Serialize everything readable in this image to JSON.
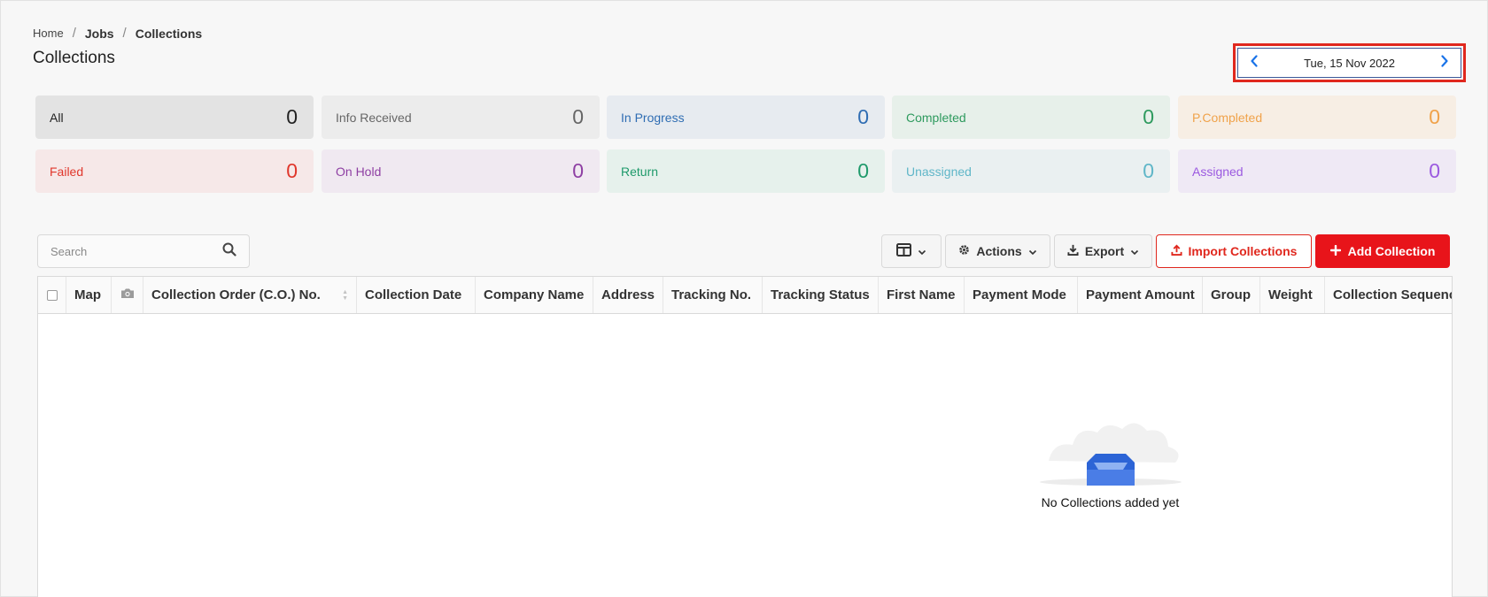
{
  "breadcrumb": {
    "home": "Home",
    "jobs": "Jobs",
    "current": "Collections",
    "separator": "/"
  },
  "page_title": "Collections",
  "date_nav": {
    "date": "Tue, 15 Nov 2022",
    "prev_icon": "chevron-left-icon",
    "next_icon": "chevron-right-icon"
  },
  "stats": [
    {
      "label": "All",
      "count": "0",
      "color": "#222222",
      "bg": "#e3e3e3"
    },
    {
      "label": "Info Received",
      "count": "0",
      "color": "#666666",
      "bg": "#ececec"
    },
    {
      "label": "In Progress",
      "count": "0",
      "color": "#2f6db3",
      "bg": "#e7ebf0"
    },
    {
      "label": "Completed",
      "count": "0",
      "color": "#2e9a5e",
      "bg": "#e7f0ea"
    },
    {
      "label": "P.Completed",
      "count": "0",
      "color": "#f0a24a",
      "bg": "#f7eee4"
    },
    {
      "label": "Failed",
      "count": "0",
      "color": "#e0372c",
      "bg": "#f6e8e8"
    },
    {
      "label": "On Hold",
      "count": "0",
      "color": "#8e3fa3",
      "bg": "#f0e9f1"
    },
    {
      "label": "Return",
      "count": "0",
      "color": "#1f9a6b",
      "bg": "#e6f1ec"
    },
    {
      "label": "Unassigned",
      "count": "0",
      "color": "#5fb6c8",
      "bg": "#eaf0f1"
    },
    {
      "label": "Assigned",
      "count": "0",
      "color": "#9b59e0",
      "bg": "#efe9f5"
    }
  ],
  "search": {
    "placeholder": "Search",
    "icon": "search-icon"
  },
  "toolbar": {
    "columns_icon": "columns-icon",
    "actions_label": "Actions",
    "export_label": "Export",
    "import_label": "Import Collections",
    "add_label": "Add Collection"
  },
  "table": {
    "columns": [
      "Map",
      "Collection Order (C.O.) No.",
      "Collection Date",
      "Company Name",
      "Address",
      "Tracking No.",
      "Tracking Status",
      "First Name",
      "Payment Mode",
      "Payment Amount",
      "Group",
      "Weight",
      "Collection Sequence"
    ],
    "empty_text": "No Collections added yet"
  }
}
